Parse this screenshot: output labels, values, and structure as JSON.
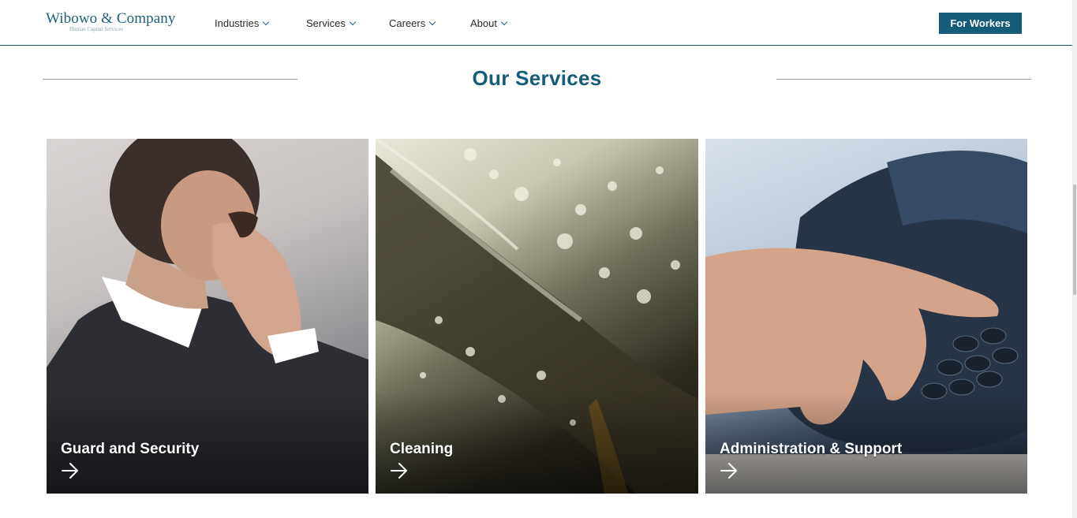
{
  "header": {
    "logo_name": "Wibowo & Company",
    "logo_tagline": "Human Capital Services",
    "nav": [
      {
        "label": "Industries",
        "icon": "chevron-down-icon"
      },
      {
        "label": "Services",
        "icon": "chevron-down-icon"
      },
      {
        "label": "Careers",
        "icon": "chevron-down-icon"
      },
      {
        "label": "About",
        "icon": "chevron-down-icon"
      }
    ],
    "cta_label": "For Workers"
  },
  "section": {
    "title": "Our Services"
  },
  "cards": [
    {
      "label": "Guard and Security",
      "image": "man-with-earpiece-photo",
      "icon": "arrow-right-icon"
    },
    {
      "label": "Cleaning",
      "image": "wet-glass-droplets-photo",
      "icon": "arrow-right-icon"
    },
    {
      "label": "Administration & Support",
      "image": "hand-dialing-phone-photo",
      "icon": "arrow-right-icon"
    }
  ],
  "colors": {
    "brand": "#155b7a",
    "text": "#2a2a2a",
    "rule": "#9a9a9a"
  }
}
